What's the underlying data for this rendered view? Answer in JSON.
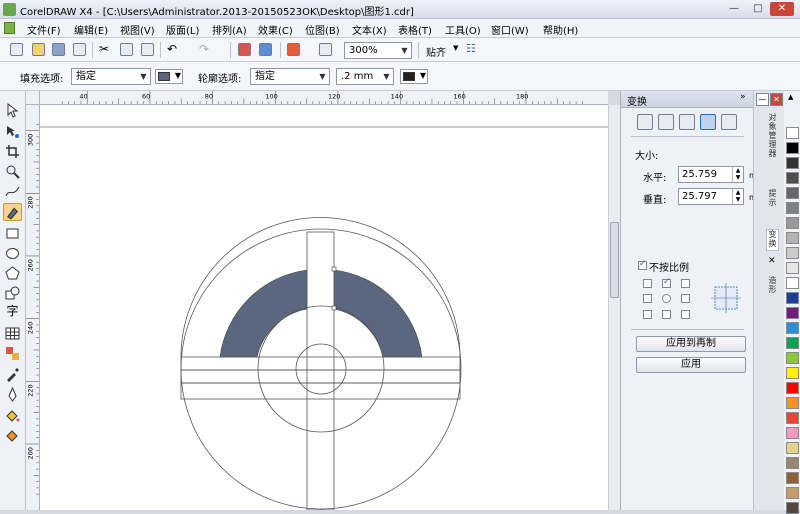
{
  "window": {
    "title": "CorelDRAW X4 - [C:\\Users\\Administrator.2013-20150523OK\\Desktop\\图形1.cdr]",
    "minimize": "—",
    "maximize": "□",
    "close": "✕"
  },
  "menu": [
    "文件(F)",
    "编辑(E)",
    "视图(V)",
    "版面(L)",
    "排列(A)",
    "效果(C)",
    "位图(B)",
    "文本(X)",
    "表格(T)",
    "工具(O)",
    "窗口(W)",
    "帮助(H)"
  ],
  "toolbar": {
    "zoom": "300%",
    "snap": "贴齐"
  },
  "propertybar": {
    "fill_label": "填充选项:",
    "fill_value": "指定",
    "fill_color": "#5b677f",
    "outline_label": "轮廓选项:",
    "outline_value": "指定",
    "outline_width": ".2 mm",
    "outline_color": "#222222"
  },
  "ruler": {
    "h_labels": [
      "40",
      "60",
      "80",
      "100",
      "120",
      "140",
      "160",
      "180"
    ],
    "v_labels": [
      "300",
      "280",
      "260",
      "240",
      "220",
      "200"
    ]
  },
  "docker": {
    "title": "变换",
    "size_label": "大小:",
    "h_label": "水平:",
    "h_value": "25.759",
    "v_label": "垂直:",
    "v_value": "25.797",
    "unit": "mm",
    "proportional_label": "不按比例",
    "apply_dup": "应用到再制",
    "apply": "应用"
  },
  "docker_tabs": {
    "tab1": "对象管理器",
    "tab2": "提示",
    "tab3": "变换",
    "tab4": "造形"
  },
  "palette_colors": [
    "#ffffff",
    "#000000",
    "#333333",
    "#4d4d4d",
    "#666666",
    "#808080",
    "#999999",
    "#b3b3b3",
    "#cccccc",
    "#e6e6e6",
    "#ffffff",
    "#1c3f94",
    "#6d1f7e",
    "#2c8fd6",
    "#00a651",
    "#8dc63f",
    "#fff200",
    "#ff0000",
    "#f7941d",
    "#ef4136",
    "#f49ac1",
    "#e1d48c",
    "#998675",
    "#8c6239",
    "#c69c6d",
    "#534741"
  ],
  "drawing": {
    "fill_color": "#5b677f"
  }
}
